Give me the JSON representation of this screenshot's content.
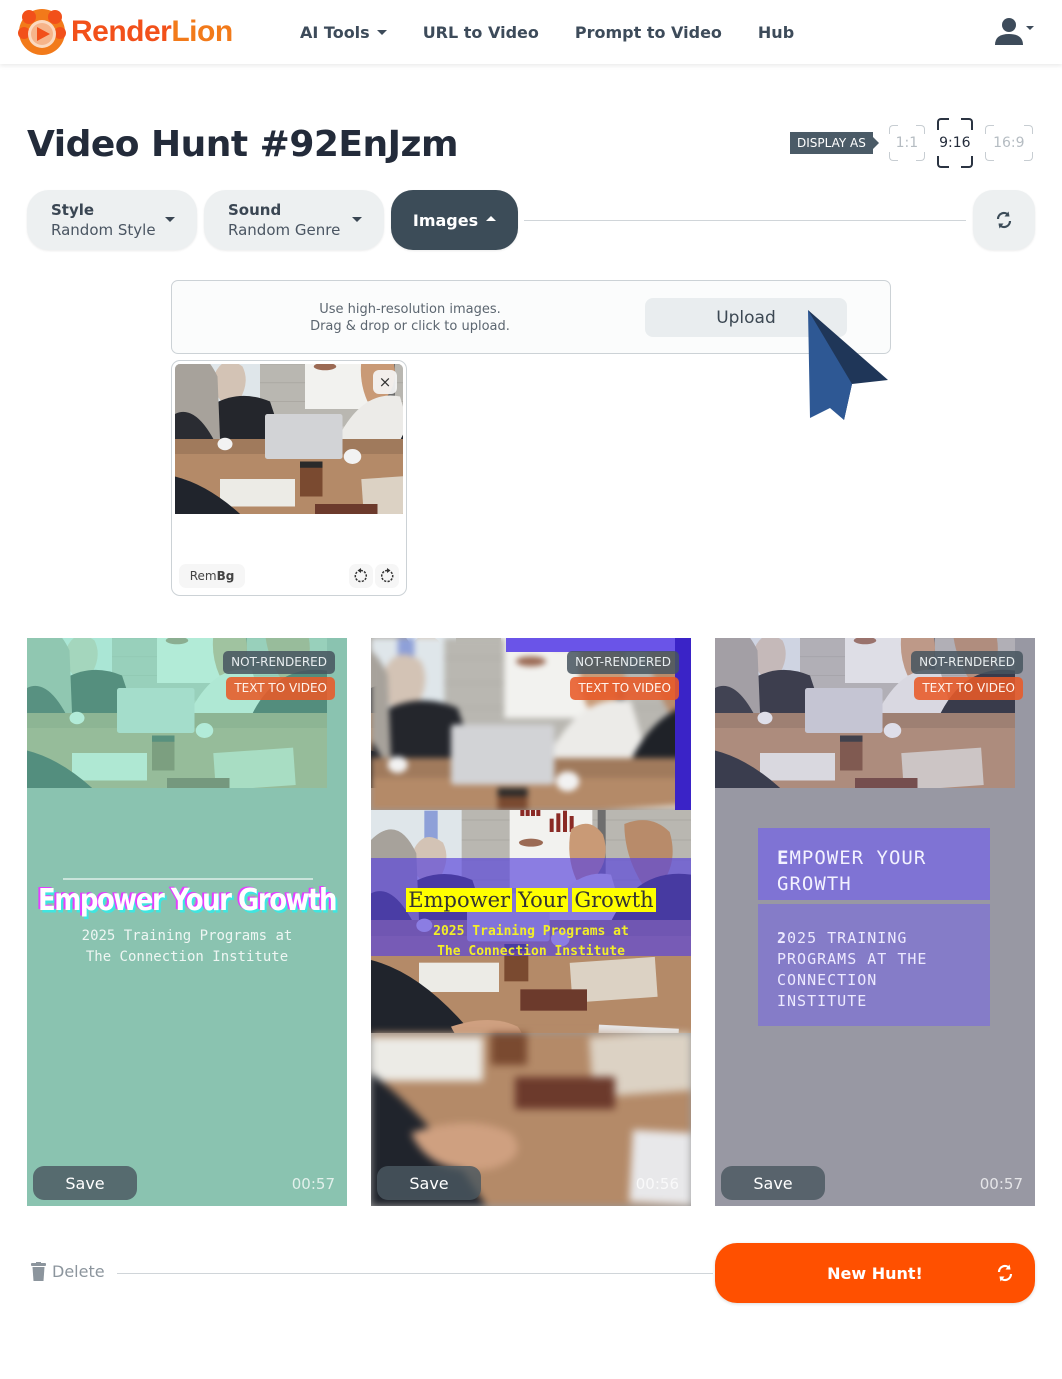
{
  "brand": {
    "name_part1": "Render",
    "name_part2": "Lion",
    "primary_color": "#f2501a",
    "accent_color": "#ff5000"
  },
  "nav": {
    "items": [
      {
        "label": "AI Tools",
        "has_dropdown": true
      },
      {
        "label": "URL to Video"
      },
      {
        "label": "Prompt to Video"
      },
      {
        "label": "Hub"
      }
    ],
    "user_icon": "user-icon"
  },
  "page": {
    "title": "Video Hunt #92EnJzm"
  },
  "display_as": {
    "label": "DISPLAY AS",
    "options": [
      "1:1",
      "9:16",
      "16:9"
    ],
    "selected": "9:16"
  },
  "filters": {
    "style": {
      "label": "Style",
      "value": "Random Style"
    },
    "sound": {
      "label": "Sound",
      "value": "Random Genre"
    },
    "images": {
      "label": "Images",
      "expanded": true
    }
  },
  "upload": {
    "hint_line1": "Use high-resolution images.",
    "hint_line2": "Drag & drop or click to upload.",
    "button_label": "Upload"
  },
  "uploaded_image": {
    "close_label": "×",
    "rembg_prefix": "Rem",
    "rembg_bold": "Bg"
  },
  "videos": [
    {
      "status": "NOT-RENDERED",
      "type": "TEXT TO VIDEO",
      "headline": "Empower Your Growth",
      "subtitle_line1": "2025 Training Programs at",
      "subtitle_line2": "The Connection Institute",
      "save_label": "Save",
      "duration": "00:57"
    },
    {
      "status": "NOT-RENDERED",
      "type": "TEXT TO VIDEO",
      "headline_words": [
        "Empower",
        "Your",
        "Growth"
      ],
      "subtitle_line1": "2025 Training Programs at",
      "subtitle_line2": "The Connection Institute",
      "save_label": "Save",
      "duration": "00:56"
    },
    {
      "status": "NOT-RENDERED",
      "type": "TEXT TO VIDEO",
      "headline_line1": "EMPOWER YOUR",
      "headline_line2": "GROWTH",
      "subtitle_lines": [
        "2025 TRAINING",
        "PROGRAMS AT THE",
        "CONNECTION",
        "INSTITUTE"
      ],
      "save_label": "Save",
      "duration": "00:57"
    }
  ],
  "footer": {
    "delete_label": "Delete",
    "new_hunt_label": "New Hunt!"
  }
}
